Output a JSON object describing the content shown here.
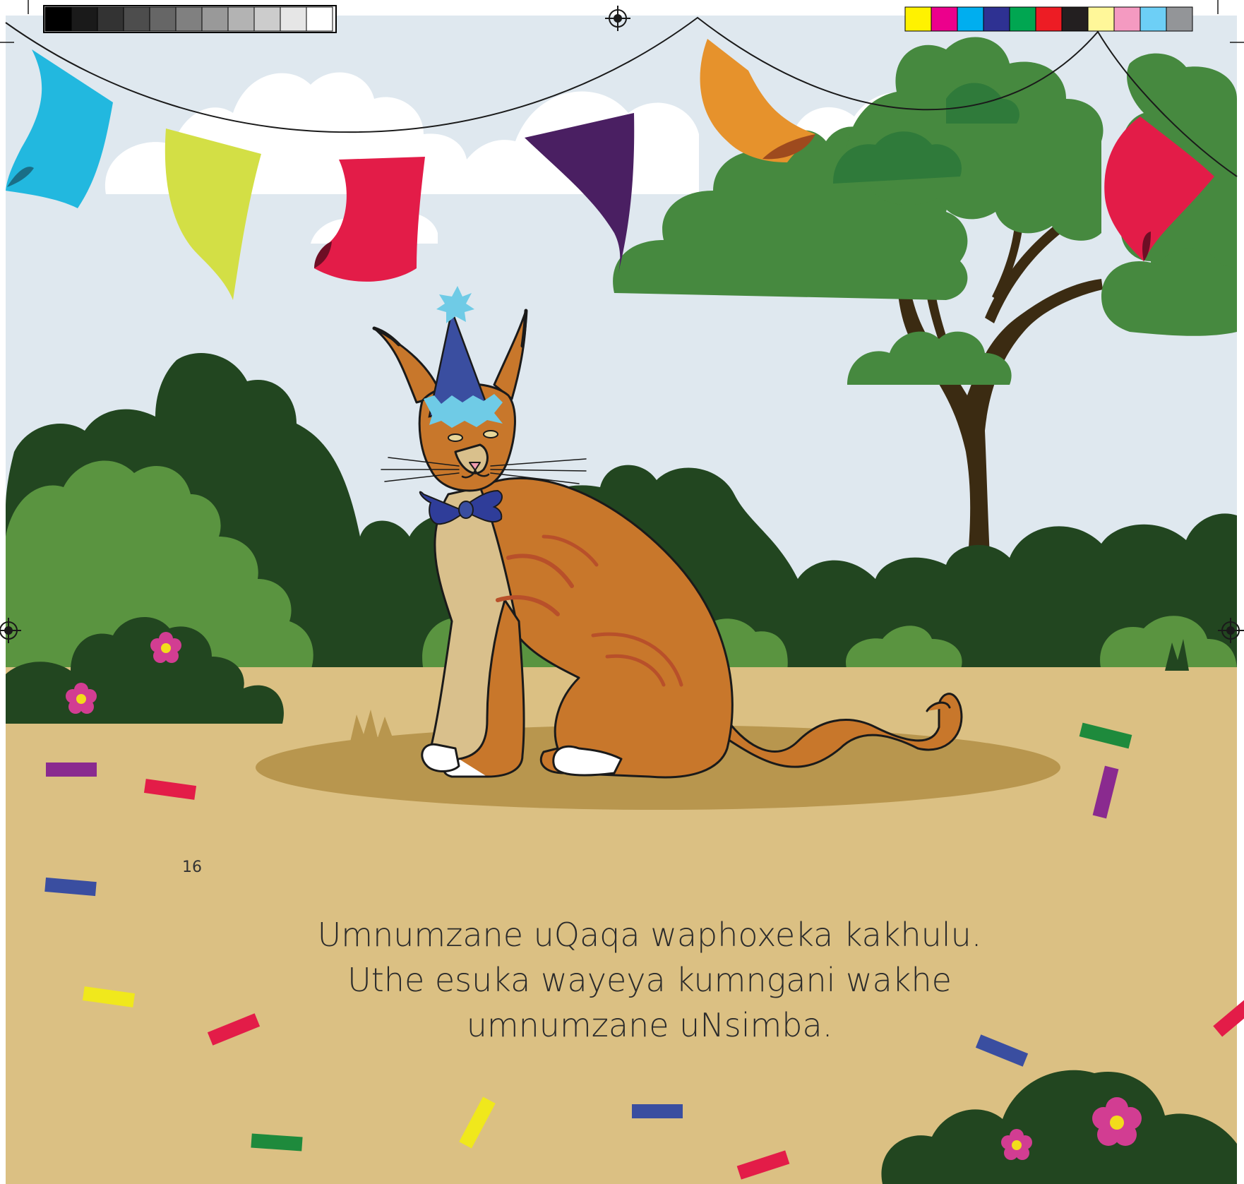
{
  "page": {
    "page_number": "16",
    "caption_lines": [
      "Umnumzane uQaqa waphoxeka kakhulu.",
      "Uthe esuka wayeya kumngani wakhe",
      "umnumzane uNsimba."
    ]
  },
  "colors": {
    "sky": "#dfe8ef",
    "ground": "#dbc083",
    "shadow": "#b8964e",
    "dark_bush": "#224620",
    "mid_bush": "#5a9440",
    "tree_leaf": "#46893f",
    "trunk": "#3b2b12",
    "caracal_body": "#c8772b",
    "caracal_stripe": "#b8502a",
    "caracal_belly": "#d9c08c",
    "hat": "#3a4ea0",
    "hat_trim": "#6fcbe6",
    "bow_tie": "#2f3d99",
    "flower": "#d23d92",
    "flower_center": "#f2dc1b"
  },
  "registration_marks": {
    "gray_swatches": [
      "#000000",
      "#1a1a1a",
      "#333333",
      "#4d4d4d",
      "#666666",
      "#808080",
      "#999999",
      "#b3b3b3",
      "#cccccc",
      "#e6e6e6",
      "#ffffff"
    ],
    "color_swatches": [
      "#fff200",
      "#ec008c",
      "#00aeef",
      "#2e3192",
      "#00a651",
      "#ed1c24",
      "#231f20",
      "#fff799",
      "#f49ac1",
      "#6dcff6",
      "#939598"
    ]
  },
  "bunting_flags": [
    "#22b8df",
    "#d3df45",
    "#e31c48",
    "#4a1f62",
    "#e6922c",
    "#e31c48"
  ],
  "icons": [
    "registration-crosshair-icon",
    "flower-icon",
    "party-hat-icon",
    "bow-tie-icon"
  ]
}
